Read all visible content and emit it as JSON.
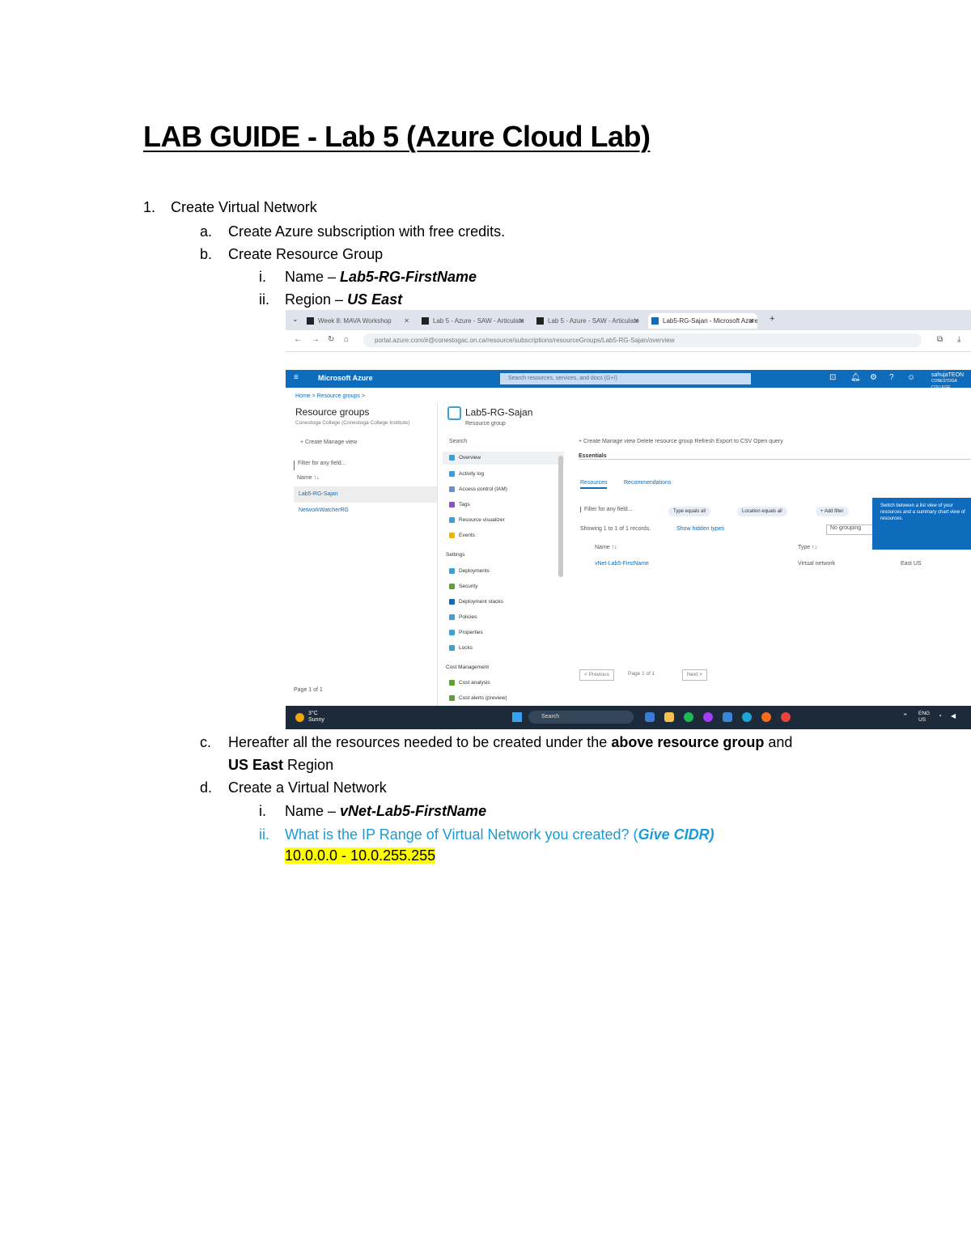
{
  "document": {
    "title": "LAB GUIDE - Lab 5 (Azure Cloud Lab)",
    "items": [
      {
        "num": "1.",
        "text": "Create Virtual Network"
      },
      {
        "num": "a.",
        "text": "Create Azure subscription with free credits."
      },
      {
        "num": "b.",
        "text": "Create Resource Group"
      },
      {
        "num": "i.",
        "prefix": "Name – ",
        "value": "Lab5-RG-FirstName"
      },
      {
        "num": "ii.",
        "prefix": "Region – ",
        "value": "US East"
      },
      {
        "num": "c.",
        "text1": "Hereafter all the resources needed to be created under the ",
        "bold1": "above resource group",
        "text2": " and",
        "bold2": "US East",
        "text3": " Region"
      },
      {
        "num": "d.",
        "text": "Create a Virtual Network"
      },
      {
        "num": "i.",
        "prefix": "Name – ",
        "value": "vNet-Lab5-FirstName"
      },
      {
        "num": "ii.",
        "question": "What is the IP Range of Virtual Network you created? (",
        "question_bold": "Give CIDR)"
      },
      {
        "answer": "10.0.0.0 - 10.0.255.255"
      }
    ]
  },
  "screenshot": {
    "tabs": [
      "Week 8: MAVA Workshop",
      "Lab 5 - Azure - SAW - Articulate",
      "Lab 5 - Azure - SAW - Articulate",
      "Lab5-RG-Sajan - Microsoft Azure"
    ],
    "url": "portal.azure.com/#@conestogac.on.ca/resource/subscriptions/resourceGroups/Lab5-RG-Sajan/overview",
    "brand": "Microsoft Azure",
    "search_placeholder": "Search resources, services, and docs (G+/)",
    "user": "sahujaTEON",
    "user_sub": "CONESTOGA COLLEGE",
    "breadcrumb": "Home > Resource groups >",
    "left_panel": {
      "title": "Resource groups",
      "subtitle": "Conestoga College (Conestoga College Institute)",
      "toolbar": "+ Create   Manage view",
      "filter": "Filter for any field...",
      "column": "Name ↑↓",
      "rows": [
        "Lab5-RG-Sajan",
        "NetworkWatcherRG"
      ],
      "pager": "Page 1 of 1"
    },
    "resource": {
      "title": "Lab5-RG-Sajan",
      "subtitle": "Resource group",
      "search": "Search",
      "menu": [
        "Overview",
        "Activity log",
        "Access control (IAM)",
        "Tags",
        "Resource visualizer",
        "Events"
      ],
      "settings_header": "Settings",
      "settings": [
        "Deployments",
        "Security",
        "Deployment stacks",
        "Policies",
        "Properties",
        "Locks"
      ],
      "cost_header": "Cost Management",
      "cost": [
        "Cost analysis",
        "Cost alerts (preview)"
      ]
    },
    "content": {
      "toolbar": "+ Create   Manage view   Delete resource group   Refresh   Export to CSV   Open query",
      "essentials": "Essentials",
      "tabs": [
        "Resources",
        "Recommendations"
      ],
      "filter": "Filter for any field...",
      "pills": [
        "Type equals all",
        "Location equals all",
        "+ Add filter"
      ],
      "showing": "Showing 1 to 1 of 1 records.",
      "show_hidden": "Show hidden types",
      "grouping": "No grouping",
      "col_name": "Name ↑↓",
      "col_type": "Type ↑↓",
      "row_name": "vNet-Lab5-FirstName",
      "row_type": "Virtual network",
      "row_loc": "East US",
      "tooltip": "Switch between a list view of your resources and a summary chart view of resources.",
      "prev": "< Previous",
      "page": "Page 1 of 1",
      "next": "Next >"
    },
    "taskbar": {
      "weather": "3°C",
      "weather_sub": "Sunny",
      "search": "Search",
      "lang": "ENG",
      "lang_sub": "US"
    }
  }
}
